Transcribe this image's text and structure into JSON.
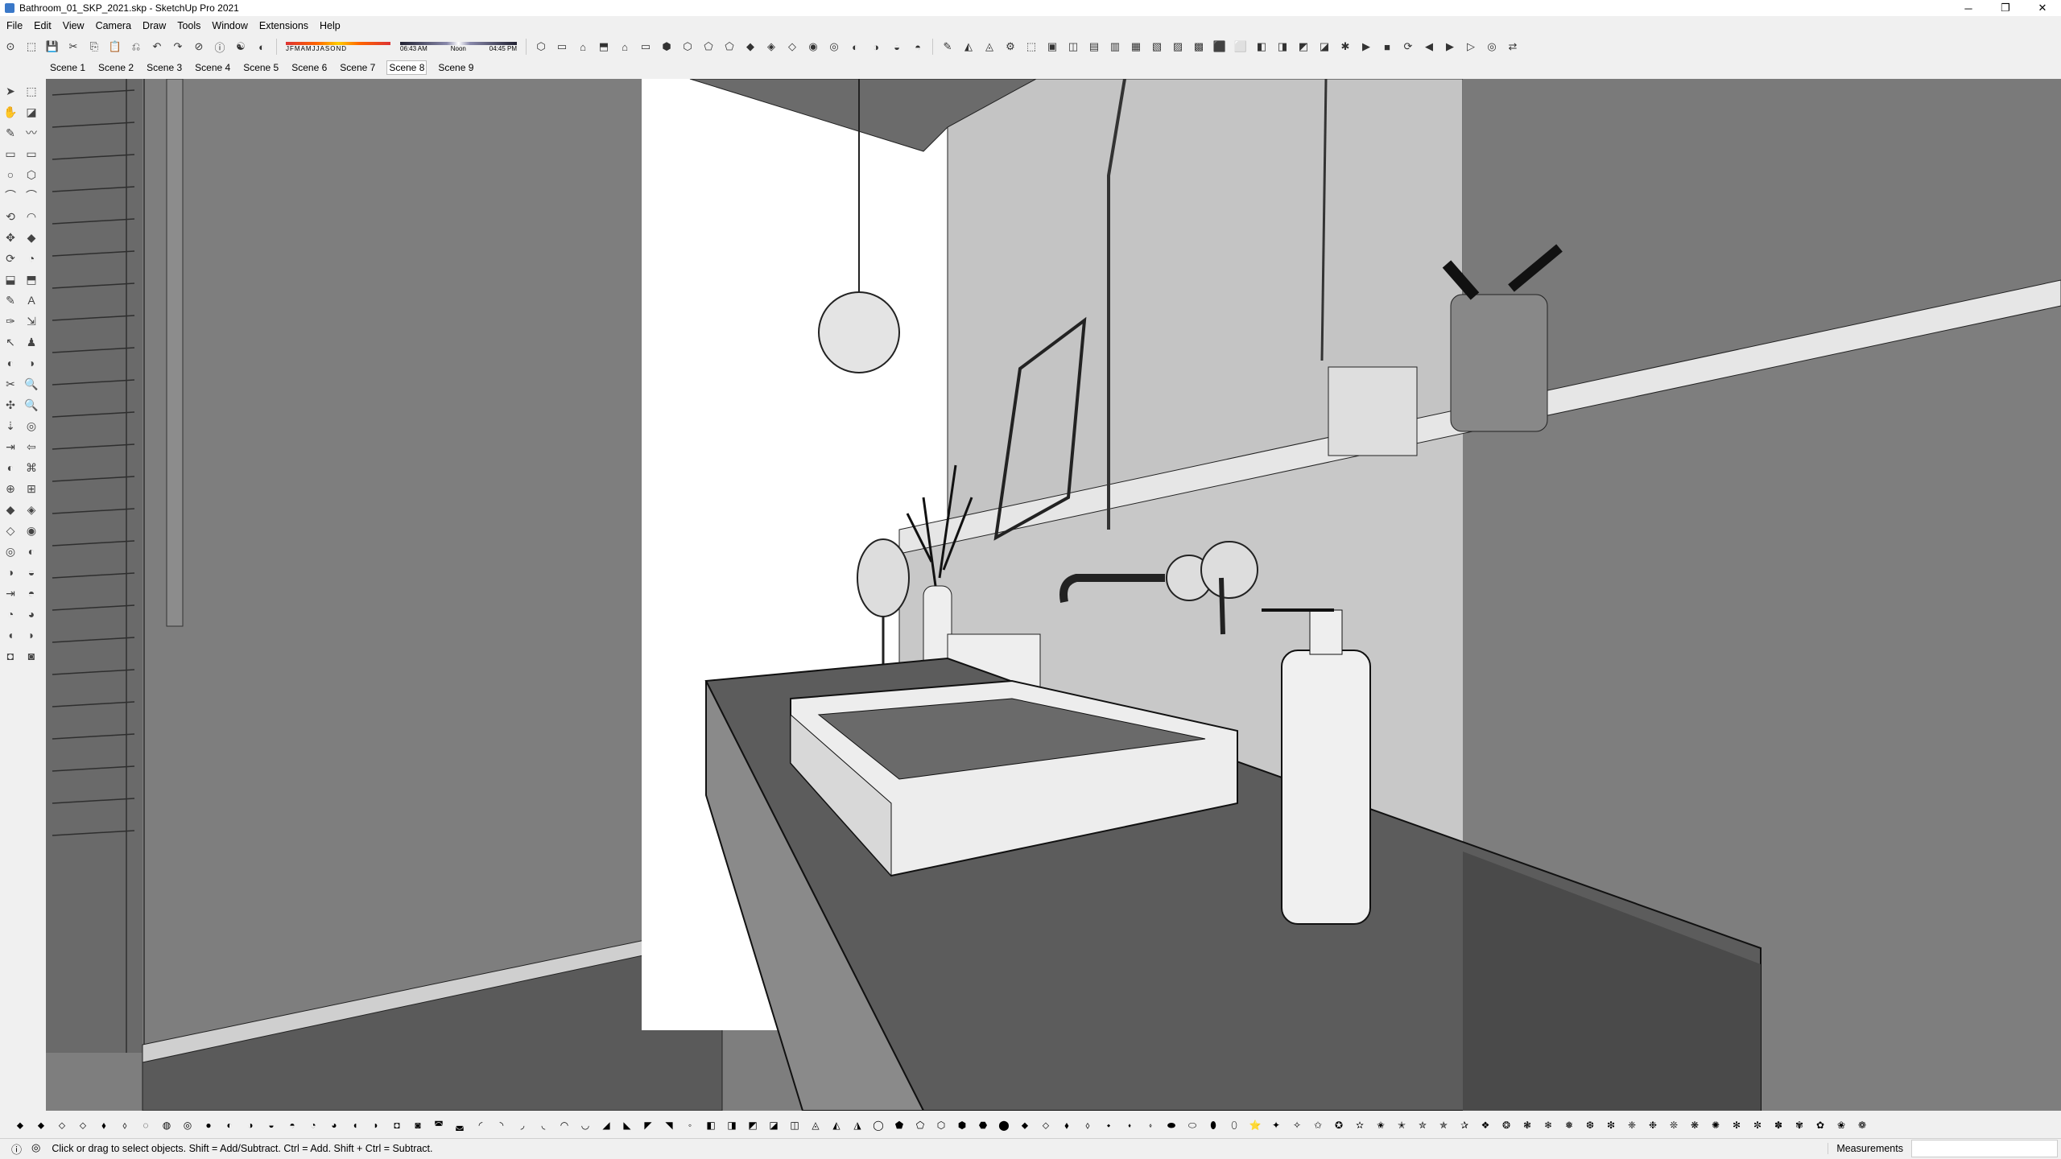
{
  "window": {
    "title": "Bathroom_01_SKP_2021.skp - SketchUp Pro 2021",
    "minimize": "─",
    "restore": "❐",
    "close": "✕"
  },
  "menu": [
    "File",
    "Edit",
    "View",
    "Camera",
    "Draw",
    "Tools",
    "Window",
    "Extensions",
    "Help"
  ],
  "shadows": {
    "months": [
      "J",
      "F",
      "M",
      "A",
      "M",
      "J",
      "J",
      "A",
      "S",
      "O",
      "N",
      "D"
    ],
    "time_start": "06:43 AM",
    "time_mid": "Noon",
    "time_end": "04:45 PM"
  },
  "scenes": {
    "tabs": [
      "Scene 1",
      "Scene 2",
      "Scene 3",
      "Scene 4",
      "Scene 5",
      "Scene 6",
      "Scene 7",
      "Scene 8",
      "Scene 9"
    ],
    "active": "Scene 8"
  },
  "status": {
    "hint": "Click or drag to select objects. Shift = Add/Subtract. Ctrl = Add. Shift + Ctrl = Subtract.",
    "measurements_label": "Measurements",
    "info_icon": "ⓘ",
    "geo_icon": "◎"
  },
  "toolbar_icons": {
    "top": [
      "⊙",
      "⬚",
      "💾",
      "✂",
      "⎘",
      "📋",
      "⎌",
      "↶",
      "↷",
      "⊘",
      "ⓘ",
      "☯",
      "◐"
    ],
    "views": [
      "⬡",
      "▭",
      "⌂",
      "⬒",
      "⌂",
      "▭",
      "⬢",
      "⬡",
      "⬠",
      "⬠",
      "◆",
      "◈",
      "◇",
      "◉",
      "◎",
      "◐",
      "◑",
      "◒",
      "◓"
    ],
    "right": [
      "✎",
      "◭",
      "◬",
      "⚙",
      "⬚",
      "▣",
      "◫",
      "▤",
      "▥",
      "▦",
      "▧",
      "▨",
      "▩",
      "⬛",
      "⬜",
      "◧",
      "◨",
      "◩",
      "◪",
      "✱",
      "▶",
      "■",
      "⟳",
      "◀",
      "▶",
      "▷",
      "◎",
      "⇄"
    ]
  },
  "left_tools": [
    "➤",
    "⬚",
    "✋",
    "◪",
    "✎",
    "〰",
    "▭",
    "▭",
    "○",
    "⬡",
    "⌒",
    "⌒",
    "⟲",
    "◠",
    "✥",
    "◆",
    "⟳",
    "◔",
    "⬓",
    "⬒",
    "✎",
    "A",
    "✑",
    "⇲",
    "↖",
    "♟",
    "◐",
    "◑",
    "✂",
    "🔍",
    "✣",
    "🔍",
    "⇣",
    "◎",
    "⇥",
    "⇦",
    "◐",
    "⌘",
    "⊕",
    "⊞",
    "◆",
    "◈",
    "◇",
    "◉",
    "◎",
    "◐",
    "◑",
    "◒",
    "⇥",
    "◓",
    "◔",
    "◕",
    "◖",
    "◗",
    "◘",
    "◙"
  ],
  "bottom_icons": [
    "⬥",
    "⬥",
    "⬦",
    "⬦",
    "⬧",
    "⬨",
    "◌",
    "◍",
    "◎",
    "●",
    "◐",
    "◑",
    "◒",
    "◓",
    "◔",
    "◕",
    "◖",
    "◗",
    "◘",
    "◙",
    "◚",
    "◛",
    "◜",
    "◝",
    "◞",
    "◟",
    "◠",
    "◡",
    "◢",
    "◣",
    "◤",
    "◥",
    "◦",
    "◧",
    "◨",
    "◩",
    "◪",
    "◫",
    "◬",
    "◭",
    "◮",
    "◯",
    "⬟",
    "⬠",
    "⬡",
    "⬢",
    "⬣",
    "⬤",
    "⬥",
    "⬦",
    "⬧",
    "⬨",
    "⬩",
    "⬪",
    "⬫",
    "⬬",
    "⬭",
    "⬮",
    "⬯",
    "⭐",
    "✦",
    "✧",
    "✩",
    "✪",
    "✫",
    "✬",
    "✭",
    "✮",
    "✯",
    "✰",
    "❖",
    "❂",
    "❃",
    "❄",
    "❅",
    "❆",
    "❇",
    "❈",
    "❉",
    "❊",
    "❋",
    "✺",
    "✻",
    "✼",
    "✽",
    "✾",
    "✿",
    "❀",
    "❁"
  ],
  "colors": {
    "viewport_bg": "#7e7e7e",
    "wall_light": "#c4c4c4",
    "wall_mid": "#7a7a7a",
    "counter": "#5c5c5c",
    "sink": "#ededed",
    "window_white": "#ffffff"
  }
}
